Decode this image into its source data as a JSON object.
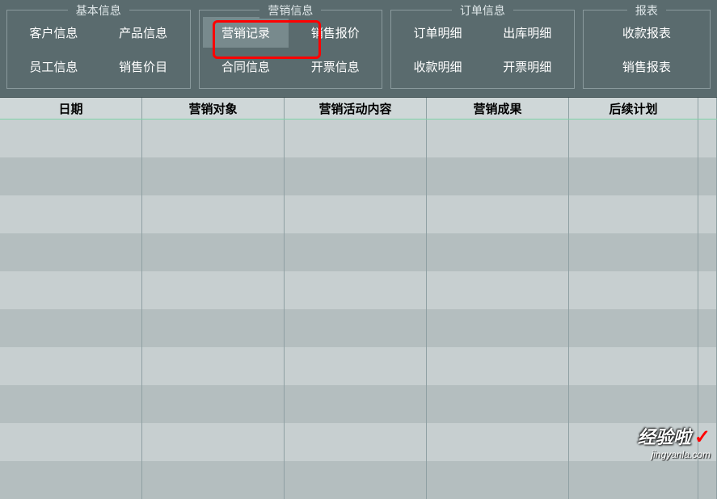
{
  "nav": {
    "groups": [
      {
        "title": "基本信息",
        "items": [
          "客户信息",
          "产品信息",
          "员工信息",
          "销售价目"
        ]
      },
      {
        "title": "营销信息",
        "items": [
          "营销记录",
          "销售报价",
          "合同信息",
          "开票信息"
        ],
        "selectedIndex": 0
      },
      {
        "title": "订单信息",
        "items": [
          "订单明细",
          "出库明细",
          "收款明细",
          "开票明细"
        ]
      },
      {
        "title": "报表",
        "items": [
          "收款报表",
          "销售报表"
        ]
      }
    ]
  },
  "table": {
    "headers": [
      "日期",
      "营销对象",
      "营销活动内容",
      "营销成果",
      "后续计划",
      ""
    ]
  },
  "watermark": {
    "main": "经验啦",
    "sub": "jingyanla.com"
  }
}
